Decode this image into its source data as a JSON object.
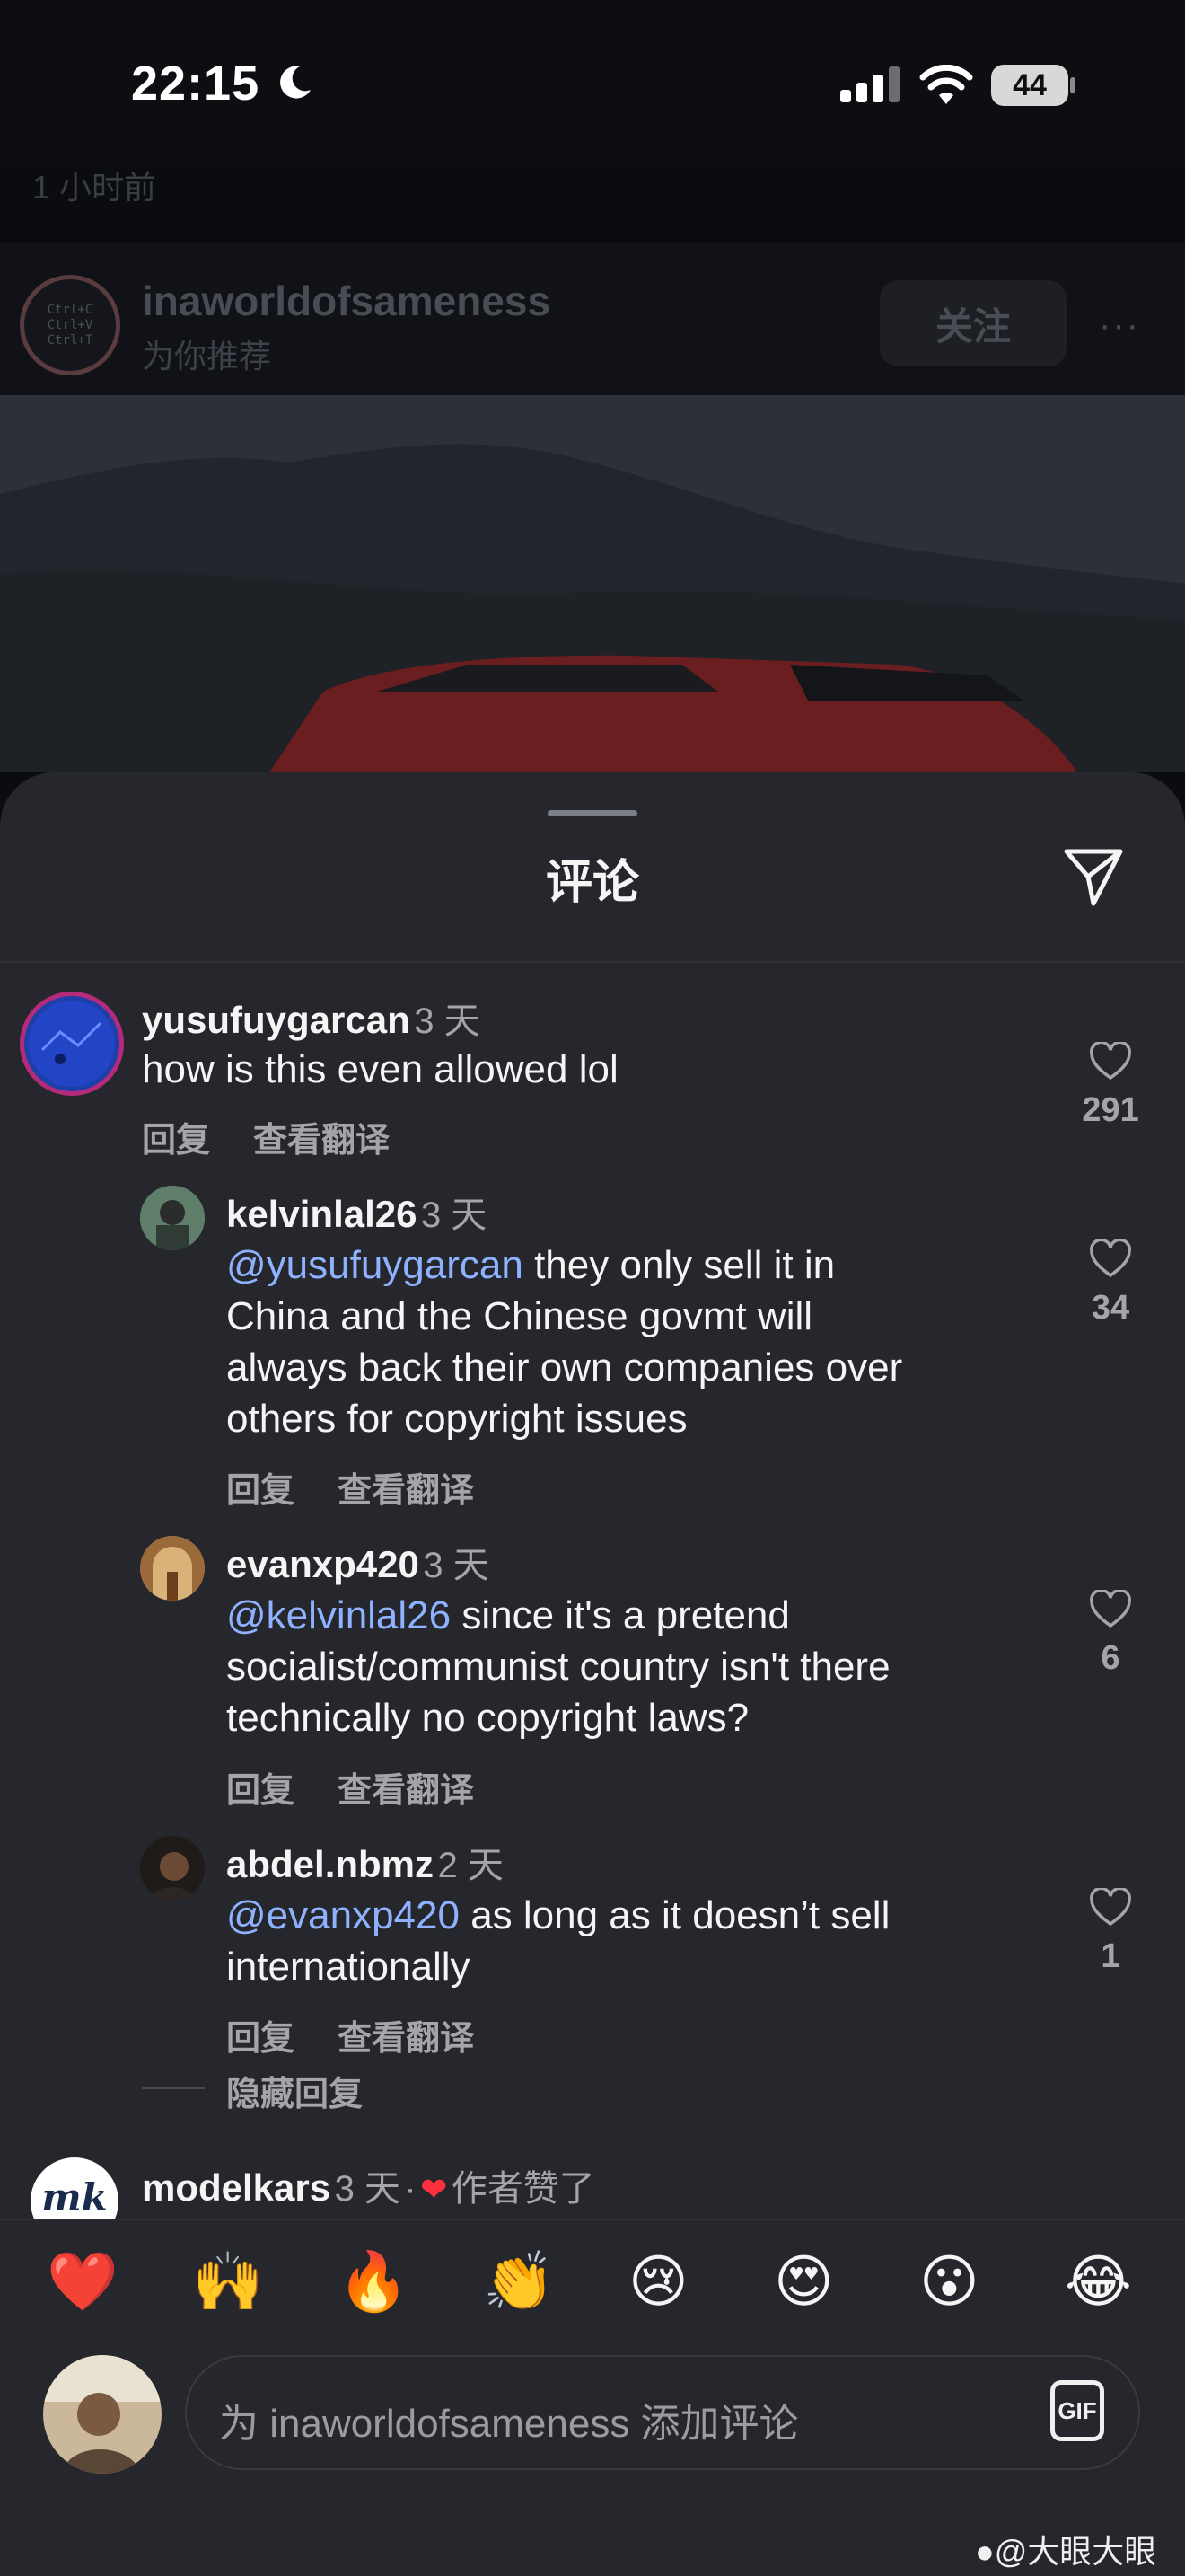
{
  "status_bar": {
    "time": "22:15",
    "battery": "44"
  },
  "post": {
    "time": "1 小时前",
    "username": "inaworldofsameness",
    "subtitle": "为你推荐",
    "follow_label": "关注",
    "more": "···",
    "avatar_lines": [
      "Ctrl+C",
      "Ctrl+V",
      "Ctrl+T"
    ]
  },
  "sheet": {
    "title": "评论"
  },
  "comments": [
    {
      "username": "yusufuygarcan",
      "age": "3 天",
      "text": "how is this even allowed lol",
      "reply": "回复",
      "translate": "查看翻译",
      "likes": "291"
    },
    {
      "username": "kelvinlal26",
      "age": "3 天",
      "mention": "@yusufuygarcan",
      "lines": [
        "they only sell it in",
        "China and the Chinese govmt will",
        "always back their own companies over",
        "others for copyright issues"
      ],
      "reply": "回复",
      "translate": "查看翻译",
      "likes": "34"
    },
    {
      "username": "evanxp420",
      "age": "3 天",
      "mention": "@kelvinlal26",
      "lines": [
        "since it's a pretend",
        "socialist/communist country isn't there",
        "technically no copyright laws?"
      ],
      "reply": "回复",
      "translate": "查看翻译",
      "likes": "6"
    },
    {
      "username": "abdel.nbmz",
      "age": "2 天",
      "mention": "@evanxp420",
      "lines": [
        "as long as it doesn’t sell",
        "internationally"
      ],
      "reply": "回复",
      "translate": "查看翻译",
      "likes": "1"
    },
    {
      "username": "modelkars",
      "age": "3 天",
      "separator": "·",
      "liked_by_author": "作者赞了",
      "avatar_text": "mk"
    }
  ],
  "hide_replies": "隐藏回复",
  "emojis": [
    "❤️",
    "🙌",
    "🔥",
    "👏",
    "😢",
    "😍",
    "😮",
    "😂"
  ],
  "composer": {
    "placeholder": "为 inaworldofsameness 添加评论",
    "gif_label": "GIF"
  },
  "watermark": "@大眼大眼",
  "colors": {
    "mention": "#8eb2ff",
    "sheet_bg": "#26272c",
    "secondary_text": "#a3a5ab"
  }
}
